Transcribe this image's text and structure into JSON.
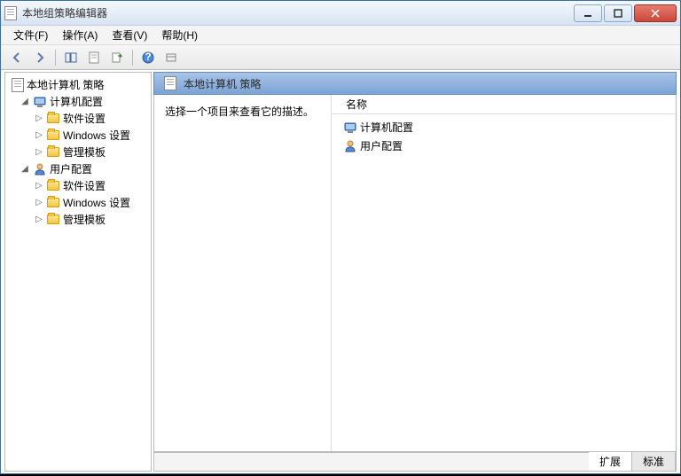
{
  "window": {
    "title": "本地组策略编辑器"
  },
  "menu": {
    "file": "文件(F)",
    "action": "操作(A)",
    "view": "查看(V)",
    "help": "帮助(H)"
  },
  "tree": {
    "root": "本地计算机 策略",
    "computer": {
      "label": "计算机配置",
      "software": "软件设置",
      "windows": "Windows 设置",
      "templates": "管理模板"
    },
    "user": {
      "label": "用户配置",
      "software": "软件设置",
      "windows": "Windows 设置",
      "templates": "管理模板"
    }
  },
  "content": {
    "header": "本地计算机 策略",
    "description": "选择一个项目来查看它的描述。",
    "column_name": "名称",
    "items": {
      "computer": "计算机配置",
      "user": "用户配置"
    }
  },
  "tabs": {
    "extended": "扩展",
    "standard": "标准"
  }
}
